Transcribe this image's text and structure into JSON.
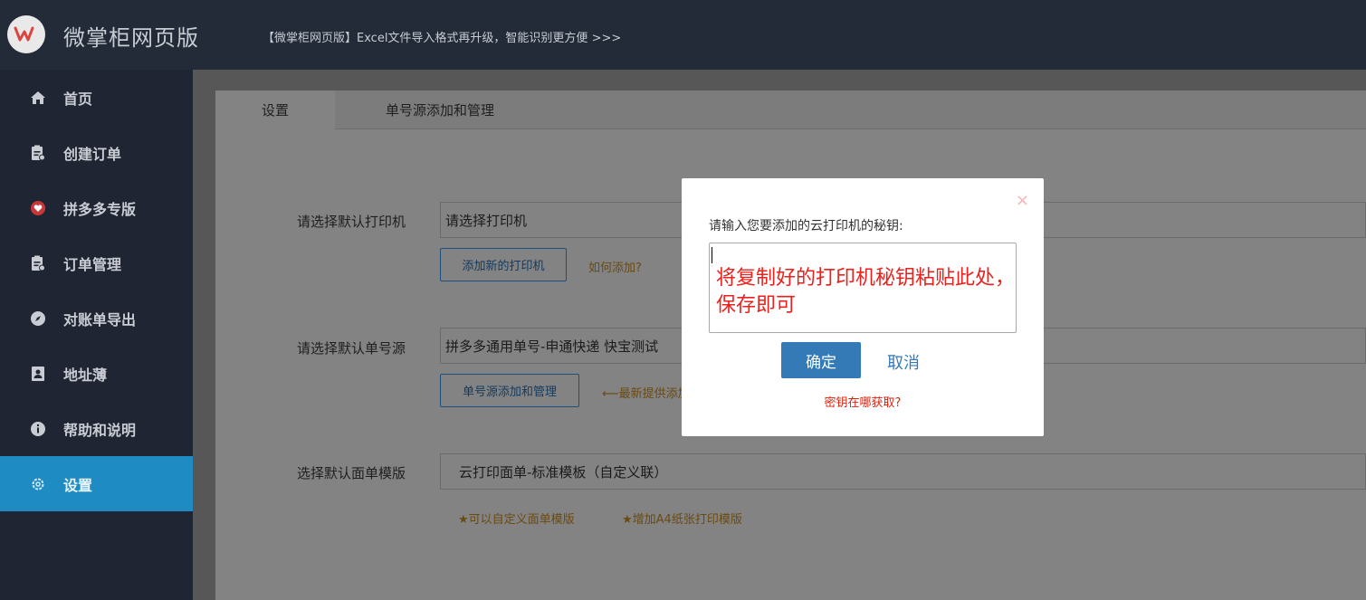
{
  "header": {
    "app_title": "微掌柜网页版",
    "announcement": "【微掌柜网页版】Excel文件导入格式再升级，智能识别更方便 >>>"
  },
  "sidebar": {
    "items": [
      {
        "label": "首页",
        "icon": "home-icon"
      },
      {
        "label": "创建订单",
        "icon": "clipboard-icon"
      },
      {
        "label": "拼多多专版",
        "icon": "heart-icon"
      },
      {
        "label": "订单管理",
        "icon": "clipboard-icon"
      },
      {
        "label": "对账单导出",
        "icon": "compass-icon"
      },
      {
        "label": "地址薄",
        "icon": "contact-card-icon"
      },
      {
        "label": "帮助和说明",
        "icon": "info-icon"
      },
      {
        "label": "设置",
        "icon": "gear-icon"
      }
    ],
    "active_index": 7
  },
  "tabs": [
    {
      "label": "设置"
    },
    {
      "label": "单号源添加和管理"
    }
  ],
  "settings": {
    "printer": {
      "label": "请选择默认打印机",
      "value": "请选择打印机",
      "add_button": "添加新的打印机",
      "help_link": "如何添加?"
    },
    "source": {
      "label": "请选择默认单号源",
      "value": "拼多多通用单号-申通快递 快宝测试",
      "manage_button": "单号源添加和管理",
      "hint": "⟵最新提供添加"
    },
    "template": {
      "label": "选择默认面单模版",
      "value": "云打印面单-标准模板（自定义联）",
      "hint1": "★可以自定义面单模版",
      "hint2": "★增加A4纸张打印模版"
    }
  },
  "modal": {
    "close": "×",
    "label": "请输入您要添加的云打印机的秘钥:",
    "input_value": "",
    "annotation": "将复制好的打印机秘钥粘贴此处，保存即可",
    "confirm": "确定",
    "cancel": "取消",
    "help": "密钥在哪获取?"
  },
  "colors": {
    "accent": "#1e8bc3",
    "primary_button": "#337ab7",
    "annotation_red": "#e8231f",
    "hint_orange": "#6a4a12"
  }
}
